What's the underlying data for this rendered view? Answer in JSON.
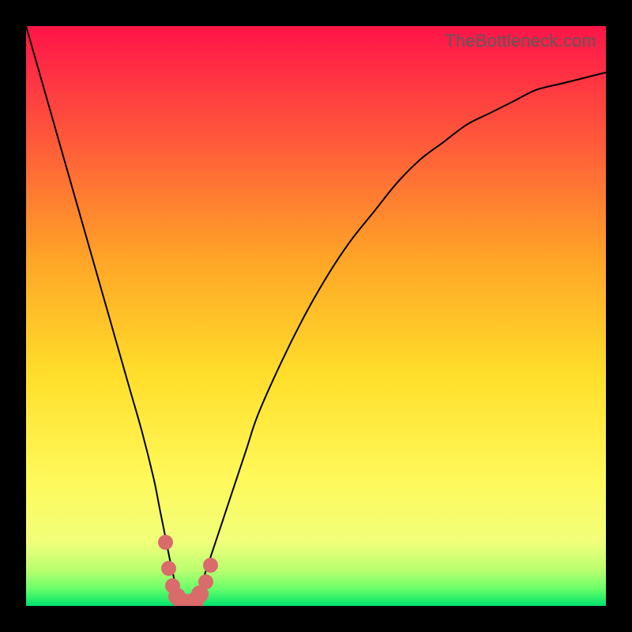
{
  "watermark": "TheBottleneck.com",
  "colors": {
    "frame": "#000000",
    "curve": "#000000",
    "marker": "#d96b6b"
  },
  "chart_data": {
    "type": "line",
    "title": "",
    "xlabel": "",
    "ylabel": "",
    "xlim": [
      0,
      100
    ],
    "ylim": [
      0,
      100
    ],
    "gradient_stops": [
      {
        "pct": 0,
        "color": "#ff1449"
      },
      {
        "pct": 20,
        "color": "#ff5a3a"
      },
      {
        "pct": 40,
        "color": "#ffa427"
      },
      {
        "pct": 60,
        "color": "#ffde2a"
      },
      {
        "pct": 78,
        "color": "#fff95a"
      },
      {
        "pct": 89,
        "color": "#f1ff7a"
      },
      {
        "pct": 94,
        "color": "#b6ff6e"
      },
      {
        "pct": 97,
        "color": "#6aff6a"
      },
      {
        "pct": 100,
        "color": "#00e36a"
      }
    ],
    "series": [
      {
        "name": "bottleneck-curve",
        "x": [
          0,
          2,
          4,
          6,
          8,
          10,
          12,
          14,
          16,
          18,
          20,
          22,
          23,
          24,
          25,
          26,
          27,
          28,
          29,
          30,
          31,
          32,
          34,
          36,
          38,
          40,
          44,
          48,
          52,
          56,
          60,
          64,
          68,
          72,
          76,
          80,
          84,
          88,
          92,
          96,
          100
        ],
        "y": [
          100,
          93,
          86,
          79,
          72,
          65,
          58,
          51,
          44,
          37,
          30,
          22,
          17,
          12,
          7,
          3,
          1,
          0,
          1,
          3,
          6,
          9,
          15,
          21,
          27,
          33,
          42,
          50,
          57,
          63,
          68,
          73,
          77,
          80,
          83,
          85,
          87,
          89,
          90,
          91,
          92
        ]
      }
    ],
    "markers": {
      "name": "valley-markers",
      "points": [
        {
          "x": 24.0,
          "y": 11.0,
          "r": 1.3
        },
        {
          "x": 24.6,
          "y": 6.5,
          "r": 1.3
        },
        {
          "x": 25.3,
          "y": 3.5,
          "r": 1.3
        },
        {
          "x": 26.0,
          "y": 1.6,
          "r": 1.5
        },
        {
          "x": 27.0,
          "y": 0.6,
          "r": 1.6
        },
        {
          "x": 28.0,
          "y": 0.3,
          "r": 1.7
        },
        {
          "x": 29.0,
          "y": 0.7,
          "r": 1.6
        },
        {
          "x": 30.0,
          "y": 2.0,
          "r": 1.5
        },
        {
          "x": 31.0,
          "y": 4.2,
          "r": 1.3
        },
        {
          "x": 31.8,
          "y": 7.0,
          "r": 1.3
        }
      ]
    }
  }
}
